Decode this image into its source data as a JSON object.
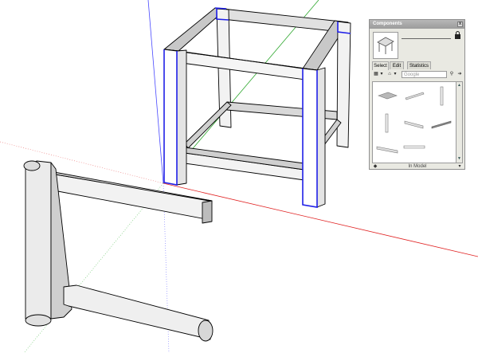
{
  "components_panel": {
    "title": "Components",
    "close_glyph": "x",
    "tabs": [
      "Select",
      "Edit",
      "Statistics"
    ],
    "active_tab": "Select",
    "search": {
      "placeholder": "Google"
    },
    "footer_label": "In Model",
    "toolbar_icons": [
      "view-options-icon",
      "dropdown-icon",
      "home-icon",
      "dropdown-icon"
    ],
    "component_items": [
      {
        "icon": "plate-icon"
      },
      {
        "icon": "beam-icon"
      },
      {
        "icon": "post-icon"
      },
      {
        "icon": "post-icon"
      },
      {
        "icon": "beam-icon"
      },
      {
        "icon": "rail-icon"
      },
      {
        "icon": "bar-icon"
      },
      {
        "icon": "bar-icon"
      }
    ]
  },
  "colors": {
    "red_axis": "#e02020",
    "green_axis": "#2fa82f",
    "blue_axis": "#3a3ae0",
    "selection": "#2020e8",
    "panel_bg": "#e9e9e2"
  }
}
